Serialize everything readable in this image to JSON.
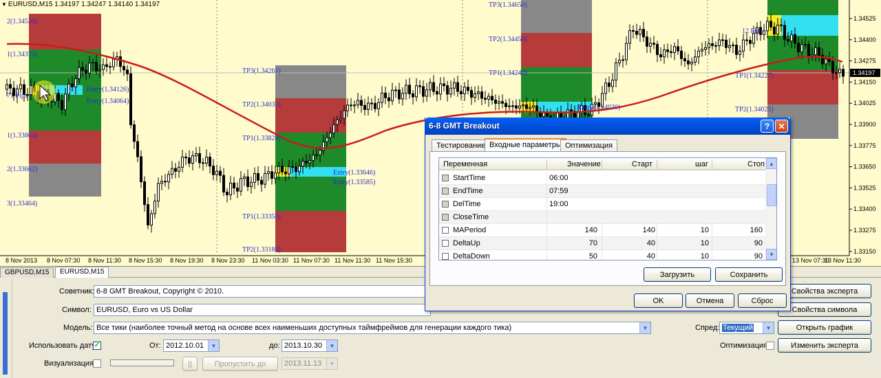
{
  "chart": {
    "header": "EURUSD,M15  1.34197 1.34247 1.34140 1.34197",
    "price_axis": [
      "1.34525",
      "1.34400",
      "1.34275",
      "1.34150",
      "1.34025",
      "1.33900",
      "1.33775",
      "1.33650",
      "1.33525",
      "1.33400",
      "1.33275",
      "1.33150"
    ],
    "current_price": "1.34197",
    "time_axis": [
      "8 Nov 2013",
      "8 Nov 07:30",
      "8 Nov 11:30",
      "8 Nov 15:30",
      "8 Nov 19:30",
      "8 Nov 23:30",
      "11 Nov 03:30",
      "11 Nov 07:30",
      "11 Nov 11:30",
      "11 Nov 15:30",
      "13 Nov 07:30",
      "13 Nov 11:30"
    ],
    "labels": {
      "b1_2": "2(1.34530)",
      "b1_1": "1(1.34370)",
      "b1_71": "71 Pips",
      "b1_entry1": "Entry(1.34126)",
      "b1_entry2": "Entry(1.34064)",
      "b1_m1": "1(1.33864)",
      "b1_m2": "2(1.33662)",
      "b1_m3": "3(1.33464)",
      "b2_tp3": "TP3(1.34261)",
      "b2_tp2": "TP2(1.34035)",
      "b2_tp1": "TP1(1.33828)",
      "b2_entry1": "Entry(1.33646)",
      "b2_entry2": "Entry(1.33585)",
      "b2_tp1b": "TP1(1.33356)",
      "b2_tp2b": "TP2(1.33180)",
      "b3_tp3": "TP3(1.34650)",
      "b3_tp2": "TP2(1.34450)",
      "b3_tp1": "TP1(1.34240)",
      "b3_entry": "Entry(1.34030)",
      "b4_12": "12 Pips",
      "b4_tp1": "TP1(1.34227)",
      "b4_tp2": "TP2(1.34025)"
    }
  },
  "symbol_tabs": [
    "GBPUSD,M15",
    "EURUSD,M15"
  ],
  "dialog": {
    "title": "6-8 GMT Breakout",
    "help": "?",
    "close": "✕",
    "tabs": [
      "Тестирование",
      "Входные параметры",
      "Оптимизация"
    ],
    "columns": [
      "Переменная",
      "Значение",
      "Старт",
      "шаг",
      "Стоп"
    ],
    "rows": [
      {
        "name": "StartTime",
        "value": "06:00",
        "start": "",
        "step": "",
        "stop": "",
        "grey": true
      },
      {
        "name": "EndTime",
        "value": "07:59",
        "start": "",
        "step": "",
        "stop": "",
        "grey": true
      },
      {
        "name": "DelTime",
        "value": "19:00",
        "start": "",
        "step": "",
        "stop": "",
        "grey": true
      },
      {
        "name": "CloseTime",
        "value": "",
        "start": "",
        "step": "",
        "stop": "",
        "grey": true
      },
      {
        "name": "MAPeriod",
        "value": "140",
        "start": "140",
        "step": "10",
        "stop": "160",
        "grey": false
      },
      {
        "name": "DeltaUp",
        "value": "70",
        "start": "40",
        "step": "10",
        "stop": "90",
        "grey": false
      },
      {
        "name": "DeltaDown",
        "value": "50",
        "start": "40",
        "step": "10",
        "stop": "90",
        "grey": false
      }
    ],
    "load": "Загрузить",
    "save": "Сохранить",
    "ok": "OK",
    "cancel": "Отмена",
    "reset": "Сброс"
  },
  "tester": {
    "advisor_label": "Советник:",
    "advisor_value": "6-8 GMT Breakout, Copyright © 2010.",
    "symbol_label": "Символ:",
    "symbol_value": "EURUSD, Euro vs US Dollar",
    "model_label": "Модель:",
    "model_value": "Все тики (наиболее точный метод на основе всех наименьших доступных таймфреймов для генерации каждого тика)",
    "use_date_label": "Использовать дату",
    "from_label": "От:",
    "from_value": "2012.10.01",
    "to_label": "до:",
    "to_value": "2013.10.30",
    "visual_label": "Визуализация",
    "pause_btn": "||",
    "skip_btn": "Пропустить до",
    "skip_date": "2013.11.13",
    "spread_label": "Спред:",
    "spread_value": "Текущий",
    "optimization_label": "Оптимизация",
    "btn_expert_props": "Свойства эксперта",
    "btn_symbol_props": "Свойства символа",
    "btn_open_chart": "Открыть график",
    "btn_modify_expert": "Изменить эксперта"
  }
}
